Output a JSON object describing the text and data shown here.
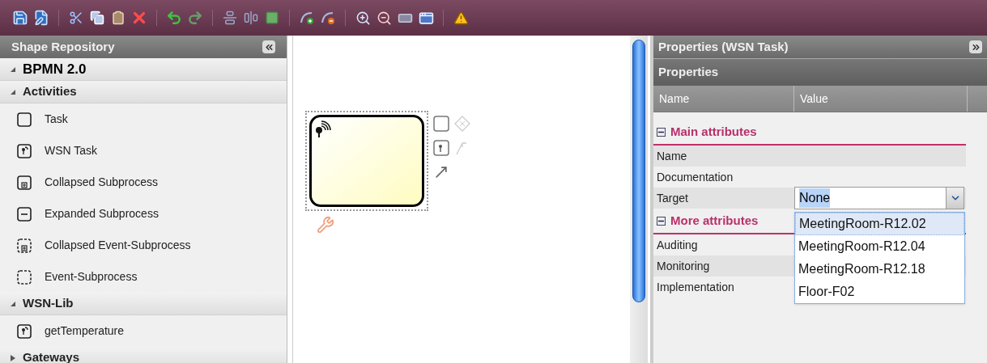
{
  "shape_repository": {
    "title": "Shape Repository",
    "sections": [
      {
        "label": "BPMN 2.0",
        "kind": "root",
        "expanded": true
      },
      {
        "label": "Activities",
        "kind": "group",
        "expanded": true,
        "items": [
          {
            "label": "Task",
            "kind": "task"
          },
          {
            "label": "WSN Task",
            "kind": "wsn-task"
          },
          {
            "label": "Collapsed Subprocess",
            "kind": "collapsed-subprocess"
          },
          {
            "label": "Expanded Subprocess",
            "kind": "expanded-subprocess"
          },
          {
            "label": "Collapsed Event-Subprocess",
            "kind": "collapsed-event-subprocess"
          },
          {
            "label": "Event-Subprocess",
            "kind": "event-subprocess"
          }
        ]
      },
      {
        "label": "WSN-Lib",
        "kind": "group",
        "expanded": true,
        "items": [
          {
            "label": "getTemperature",
            "kind": "wsn-function"
          }
        ]
      },
      {
        "label": "Gateways",
        "kind": "group",
        "expanded": false
      }
    ]
  },
  "properties": {
    "title": "Properties (WSN Task)",
    "subtitle": "Properties",
    "columns": [
      "Name",
      "Value"
    ],
    "groups": [
      {
        "label": "Main attributes",
        "expanded": true,
        "rows": [
          {
            "name": "Name"
          },
          {
            "name": "Documentation"
          },
          {
            "name": "Target",
            "value": "None",
            "kind": "select"
          }
        ]
      },
      {
        "label": "More attributes",
        "expanded": true,
        "rows": [
          {
            "name": "Auditing"
          },
          {
            "name": "Monitoring"
          },
          {
            "name": "Implementation"
          }
        ]
      }
    ],
    "dropdown": {
      "options": [
        {
          "label": "MeetingRoom-R12.02",
          "selected": true
        },
        {
          "label": "MeetingRoom-R12.04",
          "selected": false
        },
        {
          "label": "MeetingRoom-R12.18",
          "selected": false
        },
        {
          "label": "Floor-F02",
          "selected": false
        }
      ]
    }
  }
}
